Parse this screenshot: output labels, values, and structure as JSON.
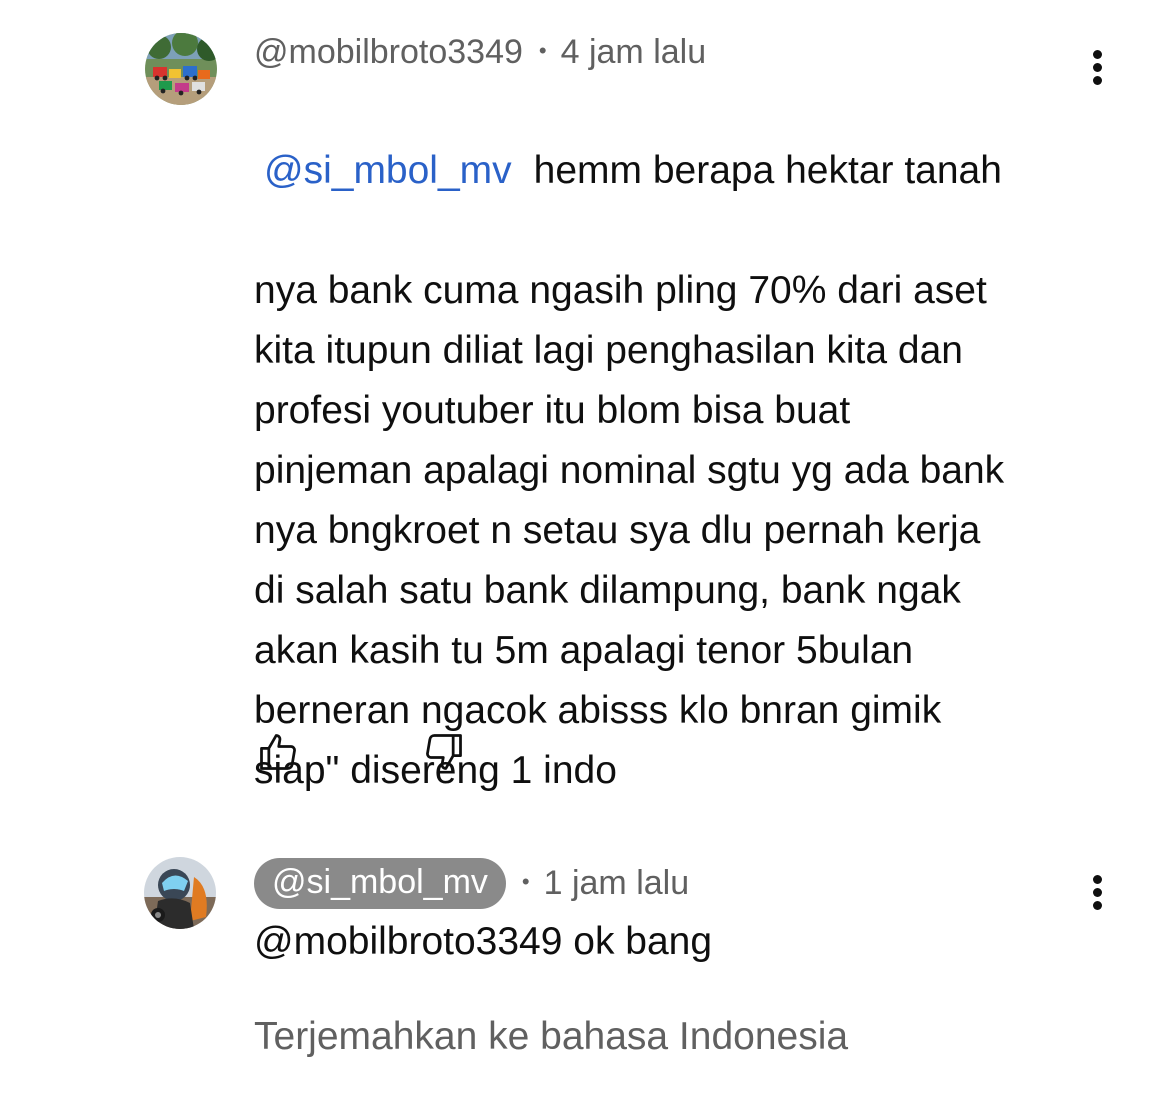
{
  "comments": [
    {
      "author": "@mobilbroto3349",
      "time": "4 jam lalu",
      "mention": "@si_mbol_mv",
      "first_line": "hemm berapa hektar tanah",
      "body_lines": "nya bank cuma ngasih pling 70% dari aset\nkita itupun diliat lagi penghasilan kita dan\nprofesi youtuber itu blom bisa buat\npinjeman apalagi nominal sgtu yg ada bank\nnya bngkroet n setau sya dlu pernah kerja\ndi salah satu bank dilampung, bank ngak\nakan kasih tu 5m apalagi tenor 5bulan\nberneran ngacok abisss  klo bnran gimik\nsiap\" disereng 1 indo",
      "avatar_icon": "toy-trucks-avatar",
      "like_icon": "thumbs-up-icon",
      "dislike_icon": "thumbs-down-icon",
      "menu_icon": "more-vert-icon"
    },
    {
      "author": "@si_mbol_mv",
      "time": "1 jam lalu",
      "text": "@mobilbroto3349 ok bang",
      "avatar_icon": "biker-helmet-avatar",
      "menu_icon": "more-vert-icon"
    }
  ],
  "translate_label": "Terjemahkan ke bahasa Indonesia",
  "separator": "•",
  "colors": {
    "mention": "#2a61c8",
    "meta_text": "#606060",
    "pill_bg": "#8a8a8a",
    "body_text": "#0f0f0f"
  }
}
